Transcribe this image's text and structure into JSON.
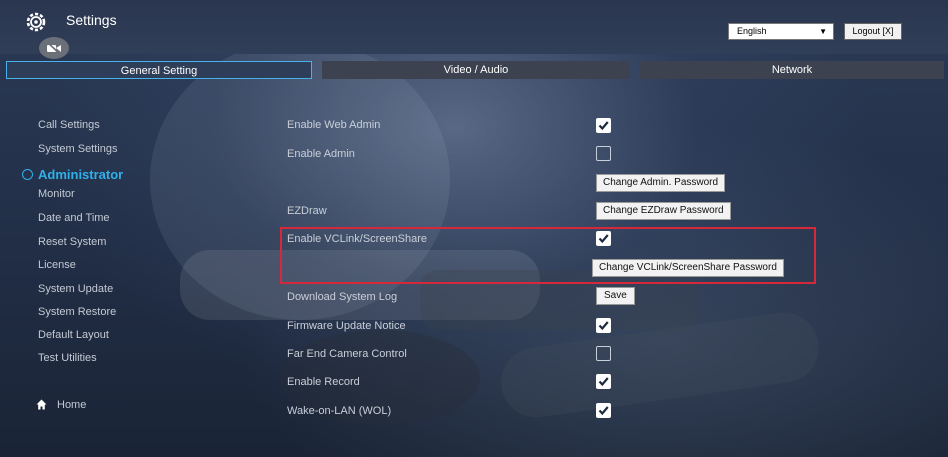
{
  "header": {
    "title": "Settings",
    "language_value": "English",
    "logout_label": "Logout [X]"
  },
  "tabs": [
    {
      "label": "General Setting",
      "active": true
    },
    {
      "label": "Video / Audio",
      "active": false
    },
    {
      "label": "Network",
      "active": false
    }
  ],
  "sidebar": {
    "items_top": [
      "Call Settings",
      "System Settings"
    ],
    "section_label": "Administrator",
    "items": [
      "Monitor",
      "Date and Time",
      "Reset System",
      "License",
      "System Update",
      "System Restore",
      "Default Layout",
      "Test Utilities"
    ],
    "home_label": "Home"
  },
  "settings": {
    "enable_web_admin": {
      "label": "Enable Web Admin",
      "checked": true
    },
    "enable_admin": {
      "label": "Enable Admin",
      "checked": false
    },
    "change_admin_password": "Change Admin. Password",
    "ezdraw": {
      "label": "EZDraw",
      "button": "Change EZDraw Password"
    },
    "enable_vclink": {
      "label": "Enable VCLink/ScreenShare",
      "checked": true
    },
    "change_vclink_password": "Change VCLink/ScreenShare Password",
    "download_log": {
      "label": "Download System Log",
      "button": "Save"
    },
    "firmware_notice": {
      "label": "Firmware Update Notice",
      "checked": true
    },
    "far_end_camera": {
      "label": "Far End Camera Control",
      "checked": false
    },
    "enable_record": {
      "label": "Enable Record",
      "checked": true
    },
    "wake_on_lan": {
      "label": "Wake-on-LAN (WOL)",
      "checked": true
    }
  },
  "colors": {
    "accent": "#2fb0ea",
    "highlight_border": "#d5283a",
    "active_tab_border": "#4ab2ea"
  }
}
